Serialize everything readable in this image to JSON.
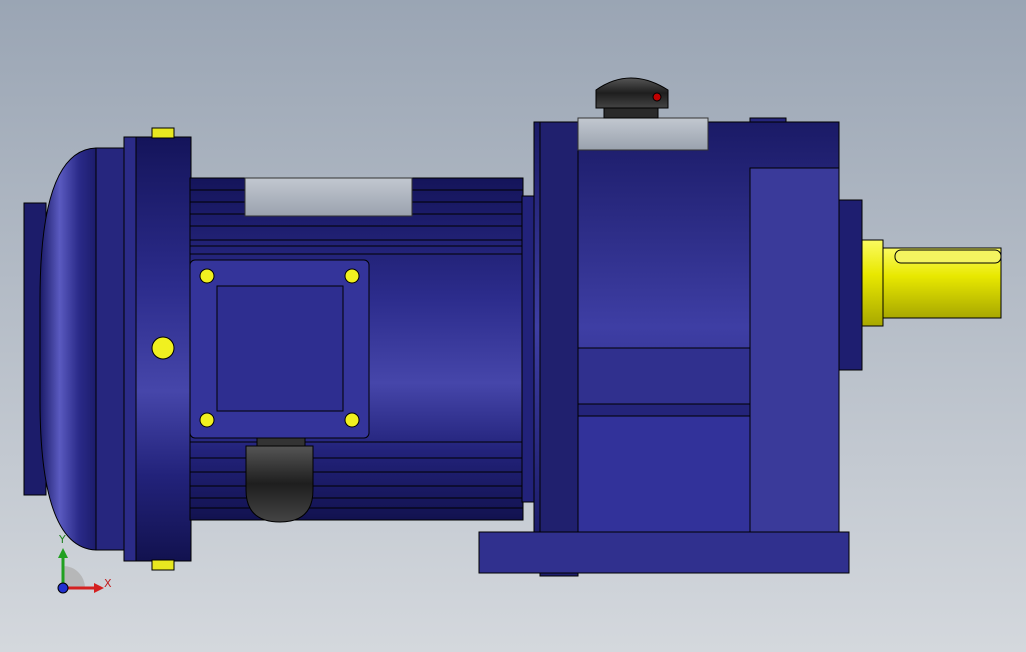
{
  "viewport": {
    "background_top": "#9aa5b4",
    "background_bottom": "#d4d8dd"
  },
  "model": {
    "body_color": "#2e2e8e",
    "body_dark": "#161660",
    "body_light": "#4a4ab0",
    "panel_color": "#3b3b98",
    "nameplate_color": "#a9b0bc",
    "shaft_color": "#e8e800",
    "bolt_color": "#f0f020",
    "knob_color": "#2a2a2a",
    "indicator_color": "#c00000"
  },
  "triad": {
    "x_label": "X",
    "y_label": "Y",
    "x_color": "#d42020",
    "y_color": "#20a020",
    "z_color": "#2030d0"
  }
}
